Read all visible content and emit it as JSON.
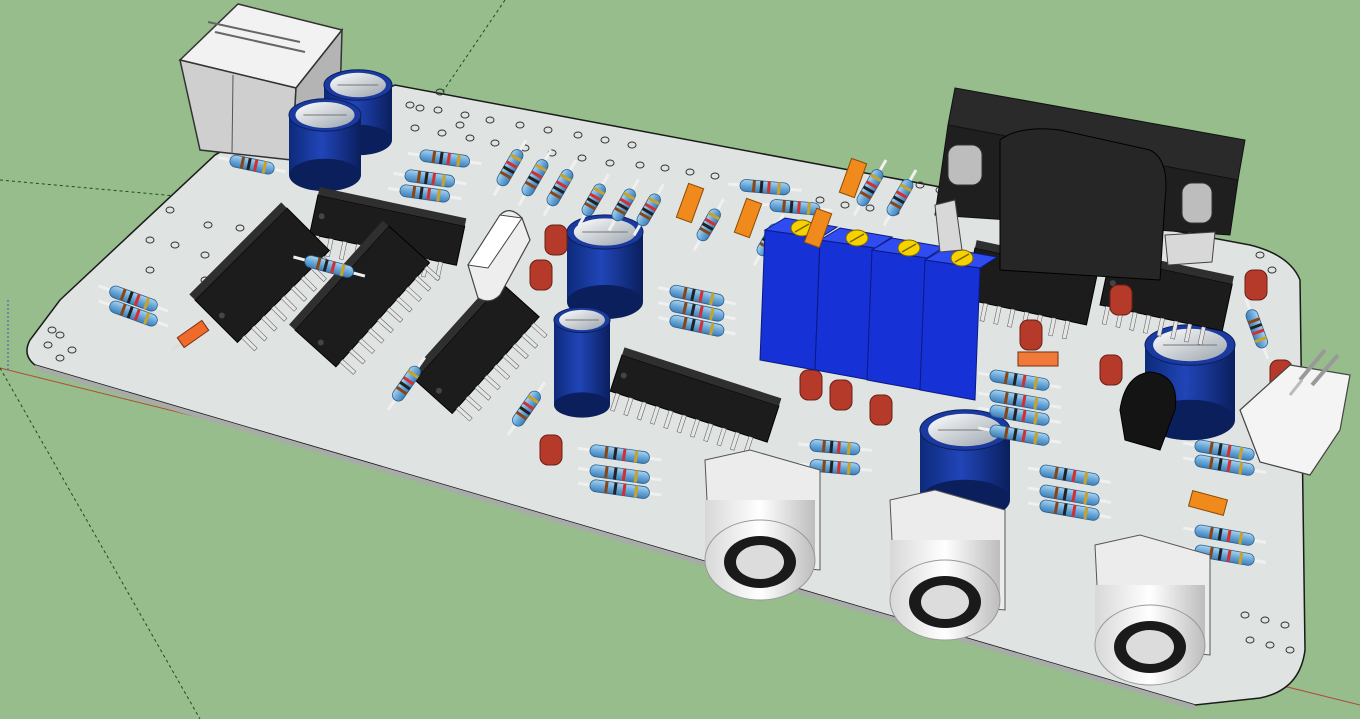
{
  "app": {
    "title": ""
  },
  "viewport": {
    "background": "#96bd8b",
    "board_color": "#dfe3e1",
    "axis_red": "#b24a3c",
    "axis_green": "#2e7d32",
    "axis_blue": "#3b55c9"
  },
  "board": {
    "ic_count": 7,
    "trimmer_count": 4,
    "rca_jack_count": 3,
    "electrolytic_capacitor_count": 6
  },
  "icons": [
    "axis-icon",
    "board-icon",
    "chip-icon",
    "capacitor-icon",
    "resistor-icon",
    "trimmer-icon",
    "rca-jack-icon",
    "usb-port-icon",
    "heatsink-icon",
    "connector-icon"
  ]
}
